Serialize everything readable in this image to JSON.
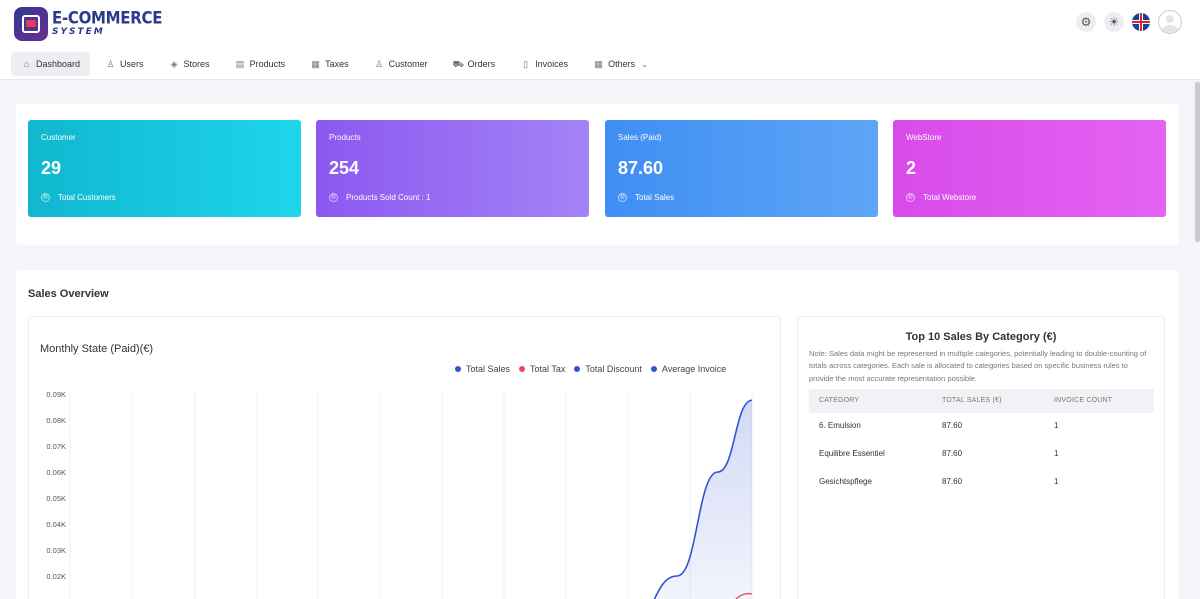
{
  "app": {
    "logo_title": "E-COMMERCE",
    "logo_subtitle": "SYSTEM"
  },
  "top_icons": [
    "settings-icon",
    "sun-icon",
    "uk-flag-icon",
    "user-avatar-icon"
  ],
  "nav": [
    {
      "label": "Dashboard",
      "icon": "dashboard-icon",
      "active": true
    },
    {
      "label": "Users",
      "icon": "user-icon"
    },
    {
      "label": "Stores",
      "icon": "layers-icon"
    },
    {
      "label": "Products",
      "icon": "products-icon"
    },
    {
      "label": "Taxes",
      "icon": "table-icon"
    },
    {
      "label": "Customer",
      "icon": "user-icon"
    },
    {
      "label": "Orders",
      "icon": "cart-icon"
    },
    {
      "label": "Invoices",
      "icon": "document-icon"
    },
    {
      "label": "Others",
      "icon": "grid-icon"
    }
  ],
  "cards": [
    {
      "label": "Customer",
      "value": "29",
      "footer": "Total Customers",
      "color_from": "#10b7cf",
      "color_to": "#1ed5ec"
    },
    {
      "label": "Products",
      "value": "254",
      "footer": "Products Sold Count : 1",
      "color_from": "#8c58f0",
      "color_to": "#a383f6"
    },
    {
      "label": "Sales (Paid)",
      "value": "87.60",
      "footer": "Total Sales",
      "color_from": "#3f8ef3",
      "color_to": "#5ea5f6"
    },
    {
      "label": "WebStore",
      "value": "2",
      "footer": "Total Webstore",
      "color_from": "#d84bea",
      "color_to": "#e463f1"
    }
  ],
  "sales_overview": {
    "title": "Sales Overview"
  },
  "monthly_chart": {
    "title": "Monthly State (Paid)(€)"
  },
  "chart_data": {
    "type": "area",
    "title": "Monthly State (Paid)(€)",
    "y_tick_labels": [
      "0.09K",
      "0.08K",
      "0.07K",
      "0.06K",
      "0.05K",
      "0.04K",
      "0.03K",
      "0.02K"
    ],
    "y_ticks": [
      90,
      80,
      70,
      60,
      50,
      40,
      30,
      20
    ],
    "ylim": [
      0,
      90
    ],
    "legend_position": "top-right",
    "grid": true,
    "series": [
      {
        "name": "Total Sales",
        "color": "#2f54d4",
        "points": [
          [
            0.0,
            0
          ],
          [
            0.75,
            0
          ],
          [
            0.82,
            0
          ],
          [
            0.89,
            20
          ],
          [
            0.95,
            60
          ],
          [
            1.0,
            87.6
          ]
        ]
      },
      {
        "name": "Total Tax",
        "color": "#e34b5f"
      },
      {
        "name": "Total Discount",
        "color": "#2f54d4"
      },
      {
        "name": "Average Invoice",
        "color": "#2f54d4"
      }
    ]
  },
  "top_sales": {
    "title": "Top 10 Sales By Category (€)",
    "note": "Note: Sales data might be represented in multiple categories, potentially leading to double-counting of totals across categories. Each sale is allocated to categories based on specific business rules to provide the most accurate representation possible.",
    "columns": [
      "CATEGORY",
      "TOTAL SALES (€)",
      "INVOICE COUNT"
    ],
    "rows": [
      [
        "6. Emulsion",
        "87.60",
        "1"
      ],
      [
        "Equilibre Essentiel",
        "87.60",
        "1"
      ],
      [
        "Gesichtspflege",
        "87.60",
        "1"
      ]
    ]
  }
}
